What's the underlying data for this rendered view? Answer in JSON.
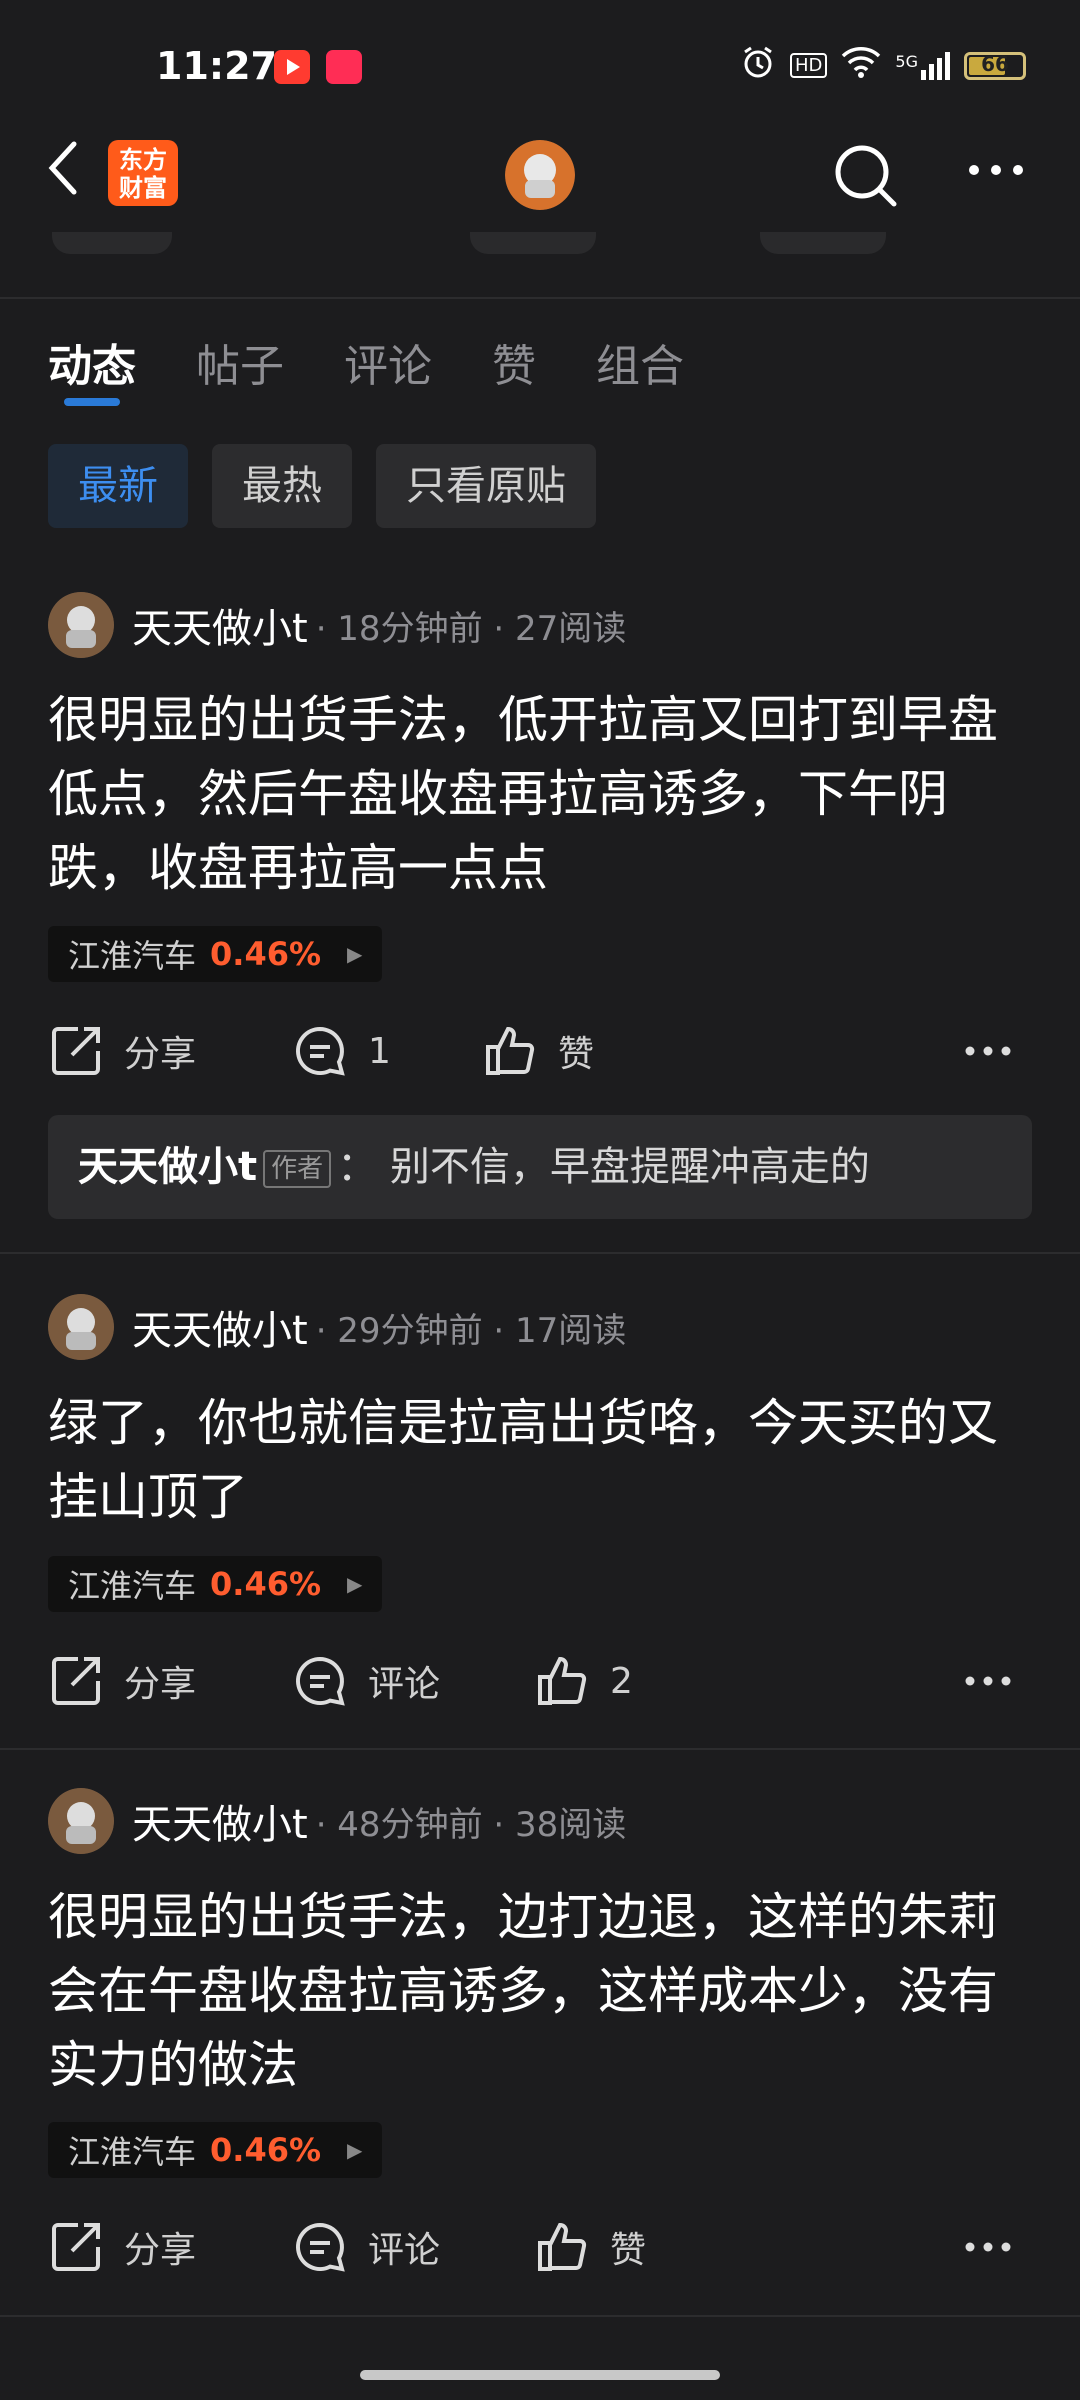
{
  "status": {
    "time": "11:27",
    "battery": "66",
    "hd": "HD",
    "net": "5G"
  },
  "nav": {
    "logo_line1": "东方",
    "logo_line2": "财富"
  },
  "tabs": [
    {
      "label": "动态",
      "active": true
    },
    {
      "label": "帖子",
      "active": false
    },
    {
      "label": "评论",
      "active": false
    },
    {
      "label": "赞",
      "active": false
    },
    {
      "label": "组合",
      "active": false
    }
  ],
  "filters": [
    {
      "label": "最新",
      "active": true
    },
    {
      "label": "最热",
      "active": false
    },
    {
      "label": "只看原贴",
      "active": false
    }
  ],
  "posts": [
    {
      "author": "天天做小t",
      "meta": "· 18分钟前 · 27阅读",
      "body": "很明显的出货手法，低开拉高又回打到早盘低点，然后午盘收盘再拉高诱多，下午阴跌，收盘再拉高一点点",
      "stock": "江淮汽车",
      "change": "0.46%",
      "share": "分享",
      "comment": "1",
      "like": "赞",
      "reply": {
        "name": "天天做小t",
        "tag": "作者",
        "text": "：  别不信，早盘提醒冲高走的"
      }
    },
    {
      "author": "天天做小t",
      "meta": "· 29分钟前 · 17阅读",
      "body": "绿了，你也就信是拉高出货咯，今天买的又挂山顶了",
      "stock": "江淮汽车",
      "change": "0.46%",
      "share": "分享",
      "comment": "评论",
      "like": "2"
    },
    {
      "author": "天天做小t",
      "meta": "· 48分钟前 · 38阅读",
      "body": "很明显的出货手法，边打边退，这样的朱莉会在午盘收盘拉高诱多，这样成本少，没有实力的做法",
      "stock": "江淮汽车",
      "change": "0.46%",
      "share": "分享",
      "comment": "评论",
      "like": "赞"
    }
  ],
  "colors": {
    "accent": "#2a7ad8",
    "up": "#ff5d2f",
    "brand": "#ff5b1a"
  }
}
